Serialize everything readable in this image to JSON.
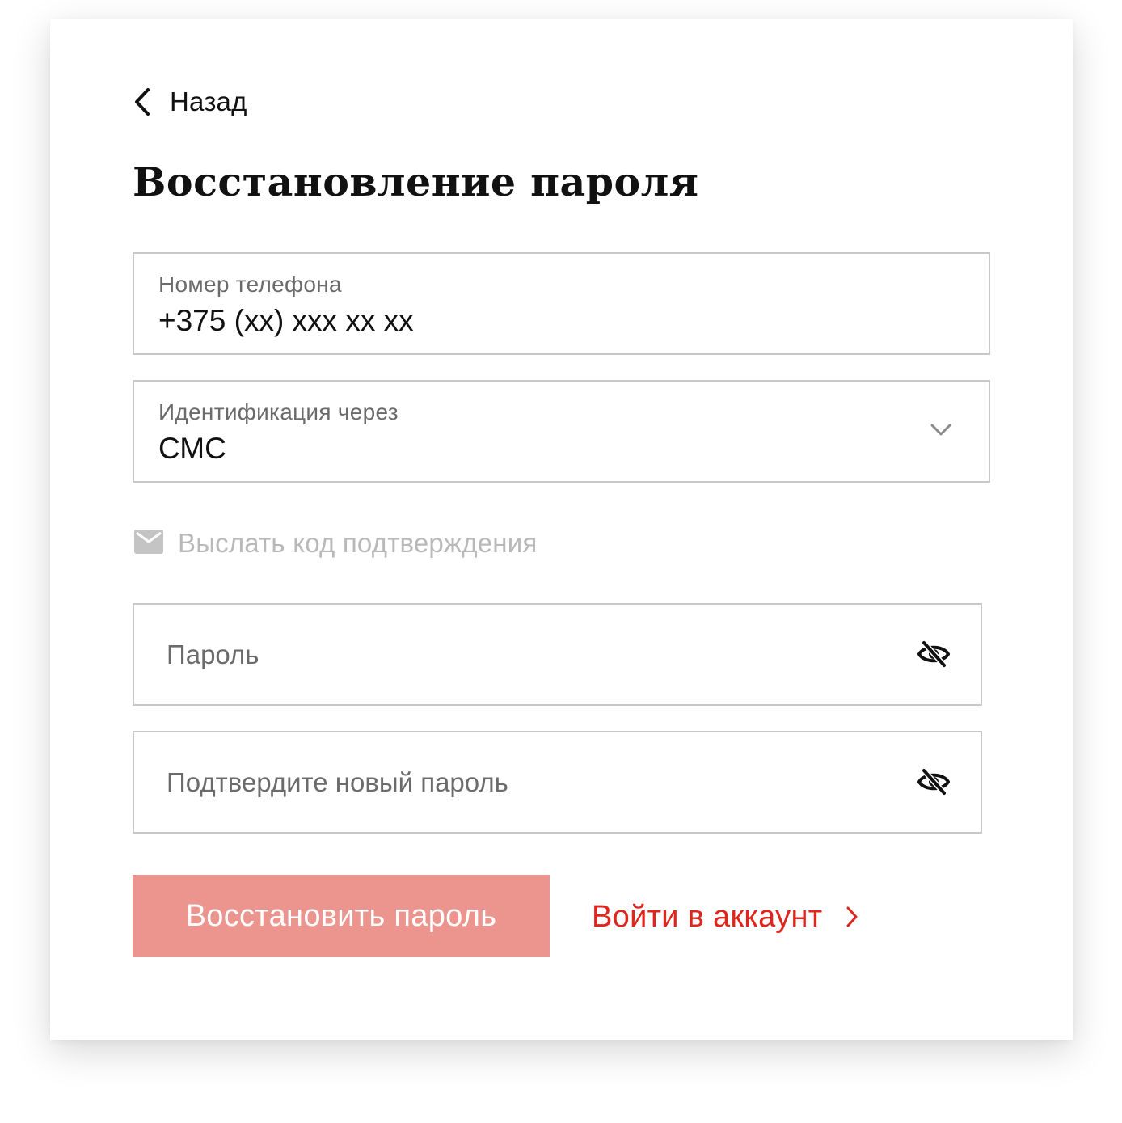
{
  "back": {
    "label": "Назад"
  },
  "title": "Восстановление пароля",
  "phone": {
    "label": "Номер телефона",
    "value": "+375 (xx) xxx xx xx"
  },
  "identification": {
    "label": "Идентификация через",
    "value": "СМС"
  },
  "send_code": {
    "label": "Выслать код подтверждения"
  },
  "password": {
    "placeholder": "Пароль"
  },
  "confirm_password": {
    "placeholder": "Подтвердите новый пароль"
  },
  "primary_button": {
    "label": "Восстановить пароль"
  },
  "login_link": {
    "label": "Войти в аккаунт"
  },
  "icons": {
    "back": "chevron-left-icon",
    "dropdown": "chevron-down-icon",
    "send_code": "envelope-icon",
    "password_visibility": "eye-off-icon",
    "login": "chevron-right-icon"
  },
  "colors": {
    "accent": "#e0251c",
    "primary_button_disabled": "#ec958f",
    "field_border": "#c8c8c8",
    "muted_text": "#6b6b6b",
    "disabled_text": "#b9b9b9"
  }
}
